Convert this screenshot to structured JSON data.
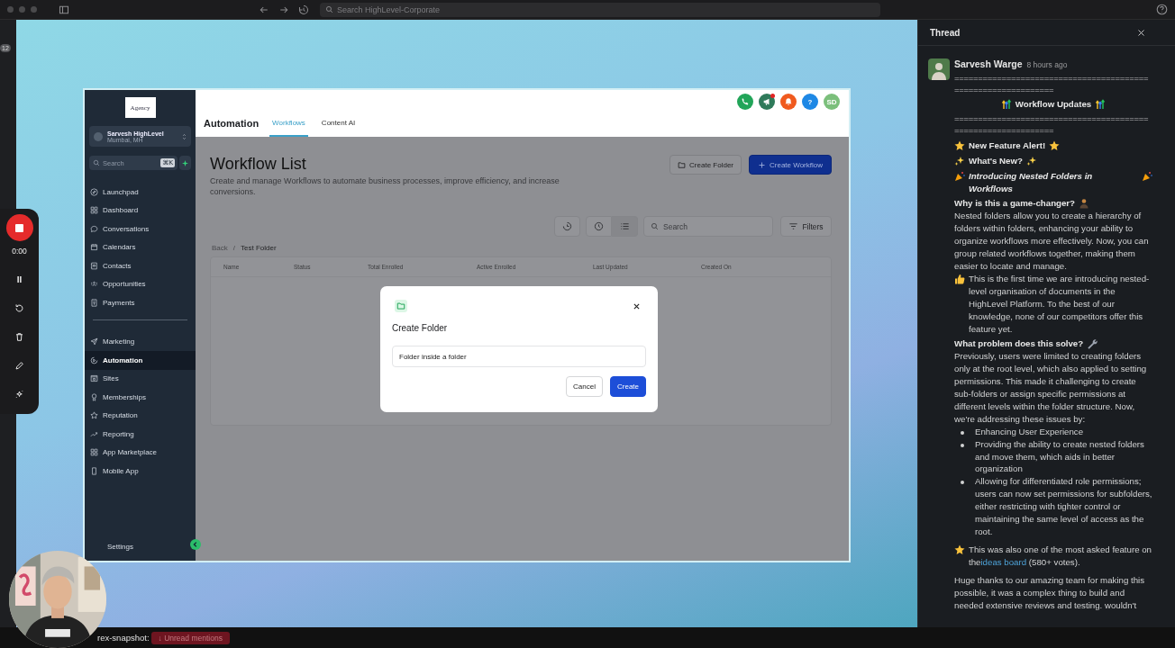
{
  "titlebar": {
    "search_placeholder": "Search HighLevel-Corporate",
    "badge": "12"
  },
  "recorder": {
    "time": "0:00"
  },
  "app": {
    "logo": "Agency",
    "account": {
      "name": "Sarvesh HighLevel",
      "location": "Mumbai, MH"
    },
    "search": {
      "placeholder": "Search",
      "shortcut": "⌘K"
    },
    "nav": [
      {
        "label": "Launchpad",
        "selected": false
      },
      {
        "label": "Dashboard",
        "selected": false
      },
      {
        "label": "Conversations",
        "selected": false
      },
      {
        "label": "Calendars",
        "selected": false
      },
      {
        "label": "Contacts",
        "selected": false
      },
      {
        "label": "Opportunities",
        "selected": false
      },
      {
        "label": "Payments",
        "selected": false
      }
    ],
    "nav_more": [
      {
        "label": "Marketing",
        "selected": false
      },
      {
        "label": "Automation",
        "selected": true
      },
      {
        "label": "Sites",
        "selected": false
      },
      {
        "label": "Memberships",
        "selected": false
      },
      {
        "label": "Reputation",
        "selected": false
      },
      {
        "label": "Reporting",
        "selected": false
      },
      {
        "label": "App Marketplace",
        "selected": false
      },
      {
        "label": "Mobile App",
        "selected": false
      }
    ],
    "settings": "Settings",
    "header": {
      "title": "Automation",
      "tabs": [
        {
          "label": "Workflows",
          "selected": true
        },
        {
          "label": "Content AI",
          "selected": false
        }
      ],
      "icons": [
        {
          "kind": "phone",
          "dot": false
        },
        {
          "kind": "megaphone",
          "dot": true
        },
        {
          "kind": "bell",
          "dot": false
        },
        {
          "kind": "help",
          "label": "?",
          "dot": false
        },
        {
          "kind": "avatar",
          "label": "SD",
          "dot": false
        }
      ]
    },
    "page": {
      "title": "Workflow List",
      "description": "Create and manage Workflows to automate business processes, improve efficiency, and increase conversions.",
      "create_folder": "Create Folder",
      "create_workflow": "Create Workflow",
      "view_toggle": [
        {
          "selected": false
        },
        {
          "selected": true
        }
      ],
      "search_placeholder": "Search",
      "filters": "Filters",
      "breadcrumb": {
        "back": "Back",
        "separator": "/",
        "current": "Test Folder"
      },
      "columns": [
        "Name",
        "Status",
        "Total Enrolled",
        "Active Enrolled",
        "Last Updated",
        "Created On"
      ]
    },
    "modal": {
      "title": "Create Folder",
      "value": "Folder inside a folder",
      "cancel": "Cancel",
      "confirm": "Create"
    }
  },
  "thread": {
    "title": "Thread",
    "author": "Sarvesh Warge",
    "time": "8 hours ago",
    "blocks": [
      {
        "kind": "rule",
        "text": "=============================================================="
      },
      {
        "kind": "heading",
        "text": "Workflow Updates"
      },
      {
        "kind": "rule",
        "text": "=============================================================="
      },
      {
        "kind": "bold",
        "text": "New Feature Alert!"
      },
      {
        "kind": "bold",
        "text": "What's New?"
      },
      {
        "kind": "bold_italic",
        "text": "Introducing Nested Folders in Workflows"
      },
      {
        "kind": "title",
        "text": "Why is this a game-changer?"
      },
      {
        "kind": "text",
        "text": "Nested folders allow you to create a hierarchy of folders within folders, enhancing your ability to organize workflows more effectively. Now, you can group related workflows together, making them easier to locate and manage."
      },
      {
        "kind": "text",
        "text": "This is the first time we are introducing nested-level organisation of documents in the HighLevel Platform. To the best of our knowledge, none of our competitors offer this feature yet."
      },
      {
        "kind": "title",
        "text": "What problem does this solve?"
      },
      {
        "kind": "text",
        "text": "Previously, users were limited to creating folders only at the root level, which also applied to setting permissions. This made it challenging to create sub-folders or assign specific permissions at different levels within the folder structure. Now, we're addressing these issues by:"
      },
      {
        "kind": "list",
        "items": [
          "Enhancing User Experience",
          "Providing the ability to create nested folders and move them, which aids in better organization",
          "Allowing for differentiated role permissions; users can now set permissions for subfolders, either restricting with tighter control or maintaining the same level of access as the root."
        ]
      },
      {
        "kind": "text",
        "text": "This was also one of the most asked feature on the",
        "link": "ideas board",
        "after": "(580+ votes)."
      },
      {
        "kind": "text",
        "text": "Huge thanks to our amazing team for making this possible, it was a complex thing to build and needed extensive reviews and testing. wouldn't"
      }
    ]
  },
  "footer": {
    "channel": "rex-snapshot:",
    "pill": "↓ Unread mentions"
  }
}
